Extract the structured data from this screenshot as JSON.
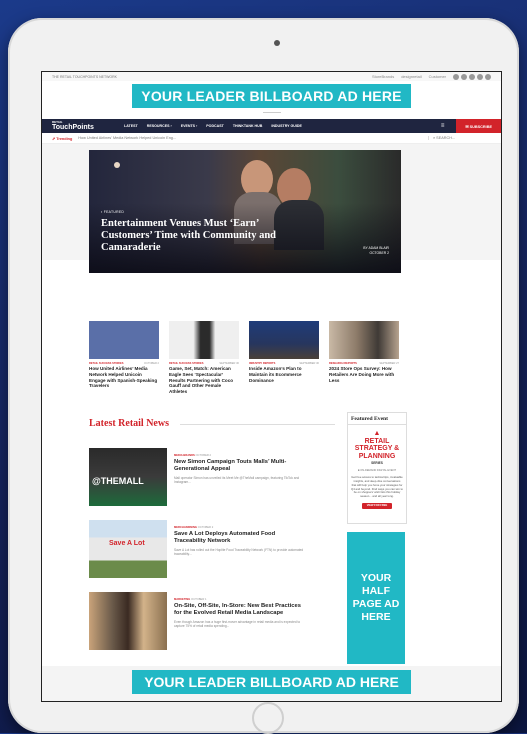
{
  "utility": {
    "left_text": "THE RETAIL TOUCHPOINTS NETWORK",
    "brand1": "StoreBrands",
    "brand2": "designretail",
    "brand3": "Customer"
  },
  "ads": {
    "top_billboard": "YOUR LEADER BILLBOARD AD HERE",
    "bottom_billboard": "YOUR LEADER BILLBOARD AD HERE",
    "half_page": "YOUR HALF PAGE AD HERE"
  },
  "nav": {
    "logo_small": "RETAIL",
    "logo": "TouchPoints",
    "items": [
      "LATEST",
      "RESOURCES ›",
      "EVENTS ›",
      "PODCAST",
      "THINKTANK HUB",
      "INDUSTRY GUIDE"
    ],
    "menu_icon": "≡",
    "subscribe": "✉ SUBSCRIBE"
  },
  "trending": {
    "label": "⇗ Trending",
    "headline": "How United Airlines' Media Network Helped Unicoin Eng...",
    "search_placeholder": "⌕ SEARCH..."
  },
  "hero": {
    "tag": "▪ FEATURED",
    "title": "Entertainment Venues Must ‘Earn’ Customers’ Time with Community and Camaraderie",
    "author": "BY ADAM BLAIR",
    "date": "OCTOBER 2"
  },
  "cards": [
    {
      "category": "RETAIL SUCCESS STORIES",
      "date": "OCTOBER 2",
      "title": "How United Airlines’ Media Network Helped Unicoin Engage with Spanish-Speaking Travelers",
      "img_color": "#5a6fa8"
    },
    {
      "category": "RETAIL SUCCESS STORIES",
      "date": "SEPTEMBER 30",
      "title": "Game, Set, Match: American Eagle Sees ‘Spectacular’ Results Partnering with Coco Gauff and Other Female Athletes",
      "img_color": "#e9e9e9"
    },
    {
      "category": "INDUSTRY REPORTS",
      "date": "SEPTEMBER 30",
      "title": "Inside Amazon’s Plan to Maintain its Ecommerce Dominance",
      "img_color": "#27365e"
    },
    {
      "category": "RESEARCH REPORTS",
      "date": "SEPTEMBER 27",
      "title": "2024 Store Ops Survey: How Retailers Are Doing More with Less",
      "img_color": "#9c8a78"
    }
  ],
  "latest": {
    "heading": "Latest Retail News",
    "articles": [
      {
        "category": "MEDIA BRANDS",
        "date": "OCTOBER 2",
        "title": "New Simon Campaign Touts Malls’ Multi-Generational Appeal",
        "snippet": "Mall operator Simon has unveiled its Meet Me @TheMall campaign, featuring TikTok and Instagram...",
        "thumb_text": "@THEMALL"
      },
      {
        "category": "MERCHANDISING",
        "date": "OCTOBER 2",
        "title": "Save A Lot Deploys Automated Food Traceability Network",
        "snippet": "Save A Lot has rolled out the Hoplite Food Traceability Network (FTN) to provide automated traceability...",
        "thumb_text": "Save A Lot"
      },
      {
        "category": "MARKETING",
        "date": "OCTOBER 1",
        "title": "On-Site, Off-Site, In-Store: New Best Practices for the Evolved Retail Media Landscape",
        "snippet": "Even though Amazon has a huge first-mover advantage in retail media and is expected to capture 75% of retail media spending...",
        "thumb_text": ""
      }
    ]
  },
  "featured_event": {
    "label": "Featured Event",
    "logo_icon": "▲",
    "title": "RETAIL STRATEGY & PLANNING",
    "series": "SERIES",
    "sub": "■ ON-DEMAND DIGITAL EVENT",
    "text": "Get free access to tactical tips, invaluable insights, and deep-dive conversations that will help you hone your strategies for Q4 and beyond. Find ways you can win to be on shoppers’ wish lists this holiday season... and all year long.",
    "button": "VIEW FOR FREE"
  }
}
